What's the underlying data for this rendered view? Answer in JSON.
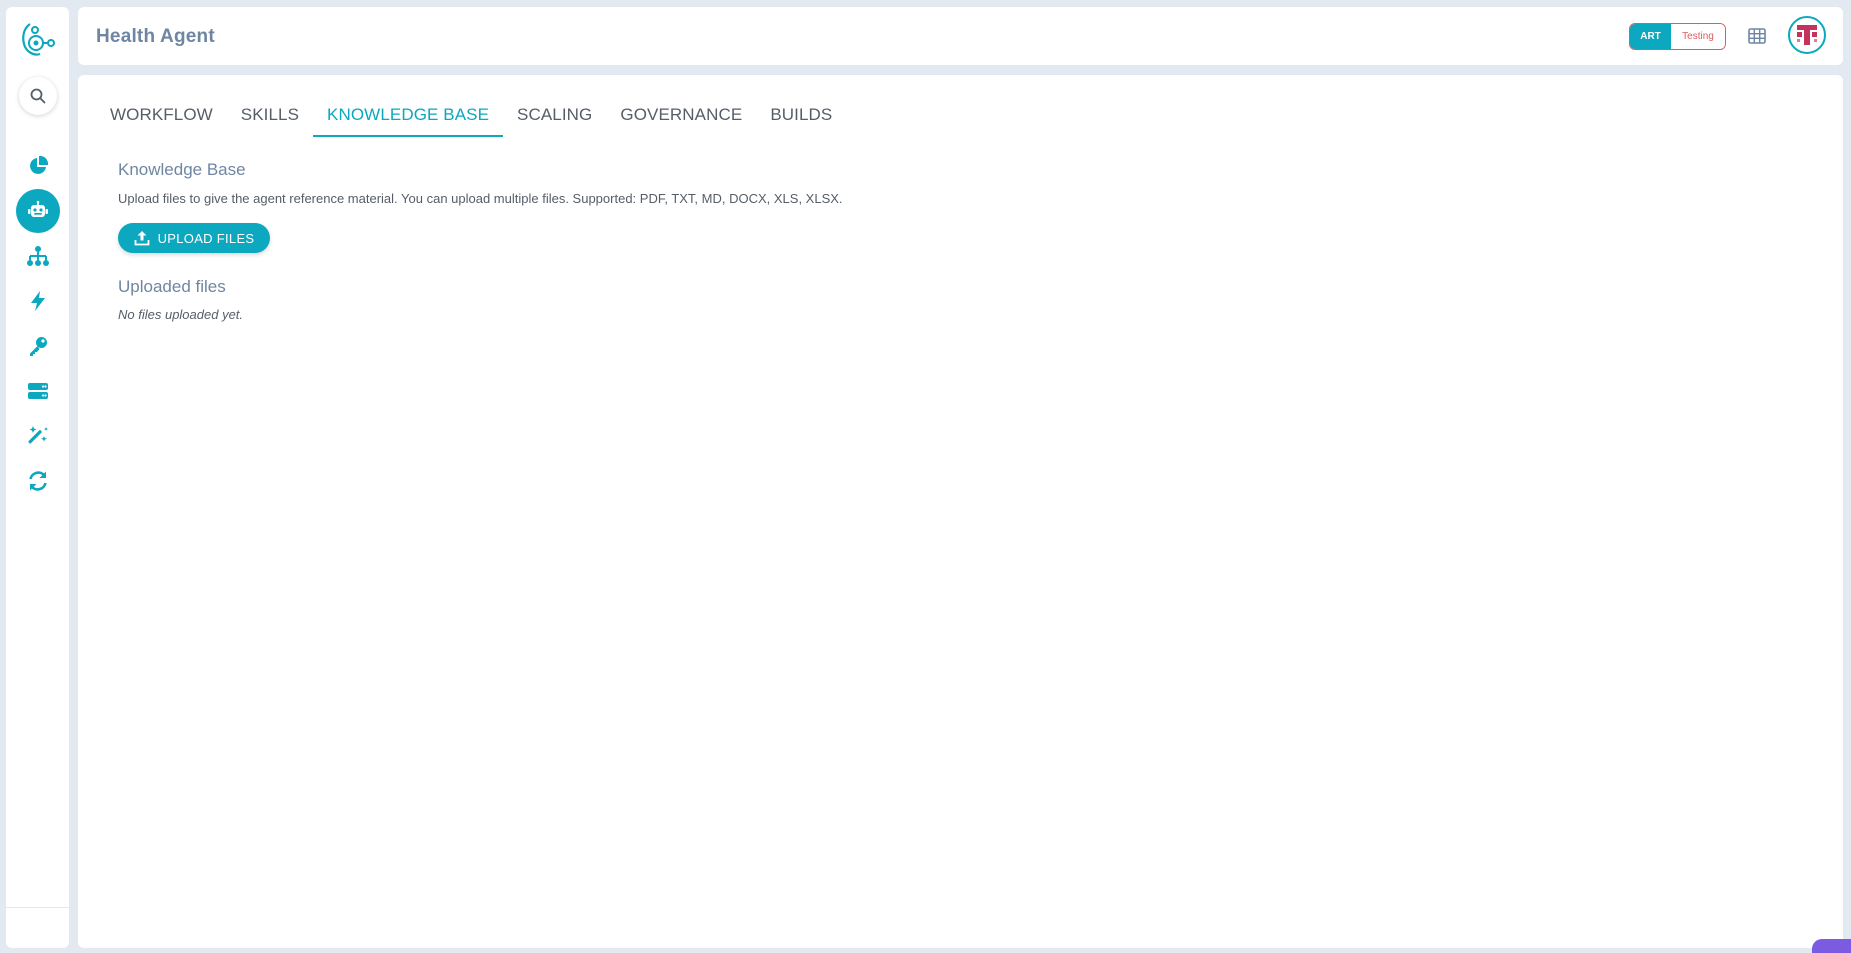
{
  "header": {
    "title": "Health Agent",
    "env_toggle": {
      "active": "ART",
      "inactive": "Testing"
    }
  },
  "sidebar": {
    "items": [
      {
        "name": "analytics",
        "icon": "pie-chart-icon",
        "active": false
      },
      {
        "name": "agents",
        "icon": "robot-icon",
        "active": true
      },
      {
        "name": "hierarchy",
        "icon": "sitemap-icon",
        "active": false
      },
      {
        "name": "triggers",
        "icon": "bolt-icon",
        "active": false
      },
      {
        "name": "keys",
        "icon": "key-icon",
        "active": false
      },
      {
        "name": "servers",
        "icon": "server-icon",
        "active": false
      },
      {
        "name": "magic",
        "icon": "magic-wand-icon",
        "active": false
      },
      {
        "name": "sync",
        "icon": "sync-icon",
        "active": false
      }
    ]
  },
  "tabs": [
    {
      "label": "WORKFLOW",
      "active": false
    },
    {
      "label": "SKILLS",
      "active": false
    },
    {
      "label": "KNOWLEDGE BASE",
      "active": true
    },
    {
      "label": "SCALING",
      "active": false
    },
    {
      "label": "GOVERNANCE",
      "active": false
    },
    {
      "label": "BUILDS",
      "active": false
    }
  ],
  "knowledge_base": {
    "title": "Knowledge Base",
    "description": "Upload files to give the agent reference material. You can upload multiple files. Supported: PDF, TXT, MD, DOCX, XLS, XLSX.",
    "upload_label": "UPLOAD FILES",
    "uploaded_title": "Uploaded files",
    "empty_text": "No files uploaded yet."
  },
  "colors": {
    "accent": "#0ba8bf",
    "title_text": "#6f86a2",
    "testing_red": "#e05c5c"
  }
}
